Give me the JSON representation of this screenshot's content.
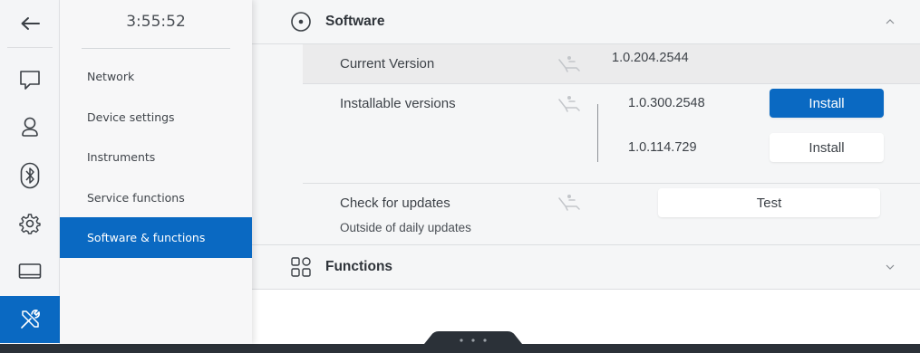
{
  "rail": {
    "items": [
      {
        "icon": "back-arrow-icon"
      },
      {
        "icon": "chat-bubble-icon"
      },
      {
        "icon": "user-icon"
      },
      {
        "icon": "bluetooth-icon"
      },
      {
        "icon": "gear-icon"
      },
      {
        "icon": "display-icon"
      },
      {
        "icon": "tools-icon"
      }
    ],
    "active_color": "#0a69c2"
  },
  "menu": {
    "clock": "3:55:52",
    "items": [
      {
        "label": "Network"
      },
      {
        "label": "Device settings"
      },
      {
        "label": "Instruments"
      },
      {
        "label": "Service functions"
      },
      {
        "label": "Software & functions"
      }
    ],
    "active_index": 4
  },
  "software": {
    "title": "Software",
    "expanded": true,
    "current_version_label": "Current Version",
    "current_version": "1.0.204.2544",
    "installable_label": "Installable versions",
    "installable": [
      {
        "version": "1.0.300.2548",
        "button": "Install",
        "primary": true
      },
      {
        "version": "1.0.114.729",
        "button": "Install",
        "primary": false
      }
    ],
    "check_label": "Check for updates",
    "check_sublabel": "Outside of daily updates",
    "check_button": "Test"
  },
  "functions": {
    "title": "Functions",
    "expanded": false
  },
  "colors": {
    "accent": "#0a69c2",
    "bottom_bar": "#2b3138"
  }
}
